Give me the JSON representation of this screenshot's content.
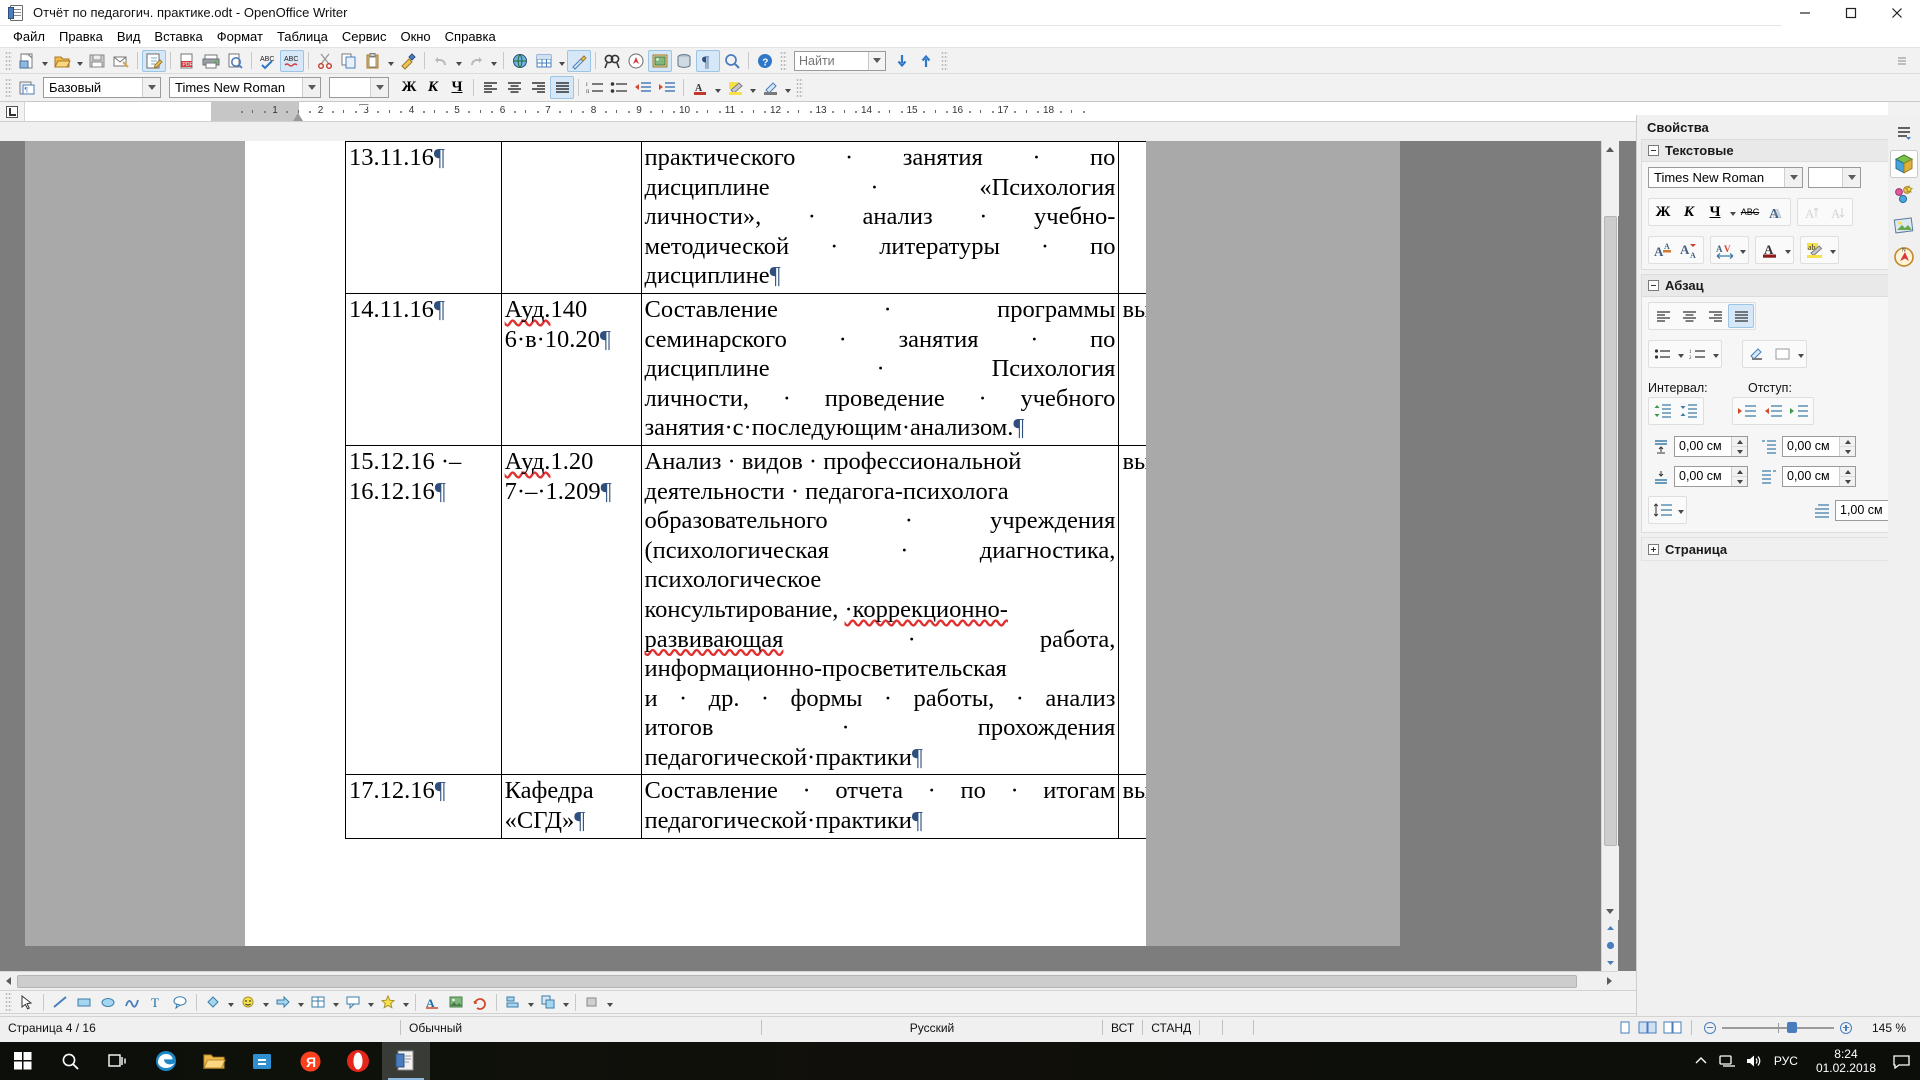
{
  "window": {
    "title": "Отчёт по педагогич. практике.odt - OpenOffice Writer",
    "app_icon": "writer-document-icon",
    "minimize": "—",
    "maximize": "□",
    "close": "✕"
  },
  "menubar": {
    "items": [
      "Файл",
      "Правка",
      "Вид",
      "Вставка",
      "Формат",
      "Таблица",
      "Сервис",
      "Окно",
      "Справка"
    ]
  },
  "standard_toolbar": {
    "find_placeholder": "Найти",
    "buttons": [
      "new-document-icon",
      "open-document-icon",
      "save-document-icon",
      "email-document-icon",
      "edit-file-icon",
      "export-pdf-icon",
      "print-icon",
      "print-preview-icon",
      "spelling-icon",
      "autospellcheck-icon",
      "cut-icon",
      "copy-icon",
      "paste-icon",
      "clone-formatting-icon",
      "undo-icon",
      "redo-icon",
      "hyperlink-icon",
      "table-icon",
      "show-draw-functions-icon",
      "find-replace-icon",
      "navigator-icon",
      "gallery-icon",
      "data-sources-icon",
      "formatting-marks-icon",
      "zoom-icon",
      "help-icon"
    ],
    "find_down": "find-next-icon",
    "find_up": "find-previous-icon"
  },
  "formatting_toolbar": {
    "paragraph_style": "Базовый",
    "font_name": "Times New Roman",
    "font_size": "",
    "bold_label": "Ж",
    "italic_label": "К",
    "underline_label": "Ч",
    "align": [
      "align-left-icon",
      "align-center-icon",
      "align-right-icon",
      "align-justified-icon"
    ],
    "active_align": "align-justified-icon",
    "buttons": [
      "apply-style-icon",
      "ordered-list-icon",
      "unordered-list-icon",
      "decrease-indent-icon",
      "increase-indent-icon",
      "paragraph-spacing-icon",
      "font-color-icon",
      "highlighting-icon",
      "background-color-icon"
    ]
  },
  "ruler": {
    "numbers": [
      "1",
      "2",
      "3",
      "4",
      "5",
      "6",
      "7",
      "8",
      "9",
      "10",
      "11",
      "12",
      "13",
      "14",
      "15",
      "16",
      "17",
      "18"
    ],
    "left_indent_marker": "indent-marker",
    "corner": "tab-stop-selector"
  },
  "document": {
    "rows": [
      {
        "date": "13.11.16",
        "place": "",
        "desc_lines": [
          "практического · занятия · по",
          "дисциплине · «Психология",
          "личности», · анализ · учебно-",
          "методической · литературы · по",
          "дисциплине"
        ],
        "mark": ""
      },
      {
        "date": "14.11.16",
        "place_lines": [
          "Ауд.140",
          "6·в·10.20"
        ],
        "place_misspelled": "Ауд.",
        "desc_lines": [
          "Составление · программы",
          "семинарского · занятия · по",
          "дисциплине · Психология",
          "личности, · проведение · учебного",
          "занятия·с·последующим·анализом."
        ],
        "mark": "выполнила"
      },
      {
        "date_lines": [
          "15.12.16 ·–",
          "16.12.16"
        ],
        "place_lines": [
          "Ауд.1.20",
          "7·–·1.209"
        ],
        "desc_lines": [
          "Анализ · видов · профессиональной",
          "деятельности · педагога-психолога",
          "образовательного · учреждения",
          "(психологическая · диагностика,",
          "психологическое",
          "консультирование, ·коррекционно-",
          "развивающая · работа,",
          "информационно-просветительская",
          "и · др. · формы · работы, · анализ",
          "итогов · прохождения",
          "педагогической·практики"
        ],
        "misspelled": "коррекционно-развивающая",
        "mark": "выполнила"
      },
      {
        "date": "17.12.16",
        "place_lines": [
          "Кафедра",
          "«СГД»"
        ],
        "desc_lines": [
          "Составление · отчета · по · итогам",
          "педагогической·практики"
        ],
        "mark": "выполнила"
      }
    ],
    "pilcrow": "¶"
  },
  "sidebar": {
    "title": "Свойства",
    "close_icon": "close-icon",
    "sections": [
      {
        "name": "Текстовые",
        "expanded": true
      },
      {
        "name": "Абзац",
        "expanded": true
      },
      {
        "name": "Страница",
        "expanded": false
      }
    ],
    "character": {
      "font_name": "Times New Roman",
      "font_size": "",
      "bold_label": "Ж",
      "italic_label": "К",
      "underline_label": "Ч",
      "strikethrough_label": "ABC",
      "shadow_label": "A",
      "buttons": [
        "increase-font-size-icon",
        "decrease-font-size-icon",
        "superscript-icon",
        "subscript-icon",
        "character-spacing-icon",
        "font-color-icon",
        "highlighting-icon"
      ]
    },
    "paragraph": {
      "align_buttons": [
        "align-left-icon",
        "align-center-icon",
        "align-right-icon",
        "align-justified-icon"
      ],
      "active_align": "align-justified-icon",
      "list_buttons": [
        "ordered-list-icon",
        "unordered-list-icon"
      ],
      "background_button": "paragraph-background-icon",
      "spacing_label": "Интервал:",
      "indent_label": "Отступ:",
      "spacing_buttons": [
        "increase-paragraph-spacing-icon",
        "decrease-paragraph-spacing-icon"
      ],
      "indent_buttons": [
        "increase-indent-icon",
        "decrease-indent-icon",
        "hanging-indent-icon"
      ],
      "spacing_above": "0,00 см",
      "spacing_below": "0,00 см",
      "indent_before": "0,00 см",
      "indent_after": "0,00 см",
      "indent_first_line": "1,00 см",
      "line_spacing_button": "line-spacing-icon"
    },
    "tabs": [
      "sidebar-settings-icon",
      "properties-tab-icon",
      "styles-tab-icon",
      "gallery-tab-icon",
      "navigator-tab-icon"
    ]
  },
  "draw_toolbar": {
    "buttons": [
      "select-icon",
      "line-icon",
      "rectangle-icon",
      "ellipse-icon",
      "freeform-line-icon",
      "text-box-icon",
      "callout-icon",
      "basic-shapes-icon",
      "symbol-shapes-icon",
      "block-arrows-icon",
      "flowchart-icon",
      "callout-shapes-icon",
      "stars-icon",
      "fontwork-icon",
      "from-file-icon",
      "rotate-icon",
      "alignment-icon",
      "arrange-icon"
    ]
  },
  "statusbar": {
    "page": "Страница 4 / 16",
    "page_style": "Обычный",
    "language": "Русский",
    "insert_mode": "ВСТ",
    "selection_mode": "СТАНД",
    "view_layouts": [
      "single-page-view-icon",
      "multi-page-view-icon",
      "book-view-icon"
    ],
    "zoom_out": "zoom-out-icon",
    "zoom_in": "zoom-in-icon",
    "zoom_level": "145 %"
  },
  "taskbar": {
    "start": "windows-start-icon",
    "search": "search-icon",
    "task_view": "task-view-icon",
    "pinned": [
      {
        "name": "edge-icon",
        "label": "e"
      },
      {
        "name": "file-explorer-icon",
        "label": ""
      },
      {
        "name": "store-icon",
        "label": ""
      },
      {
        "name": "yandex-browser-icon",
        "label": "Y"
      },
      {
        "name": "opera-icon",
        "label": "O"
      },
      {
        "name": "openoffice-writer-icon",
        "label": "",
        "active": true
      }
    ],
    "tray": {
      "show_hidden": "chevron-up-icon",
      "network": "network-icon",
      "volume": "volume-icon",
      "language": "РУС",
      "time": "8:24",
      "date": "01.02.2018",
      "notifications": "notification-icon"
    }
  }
}
